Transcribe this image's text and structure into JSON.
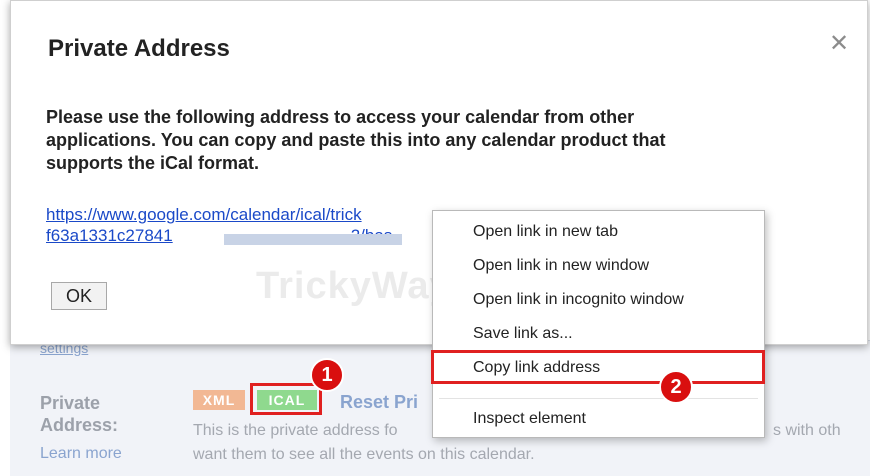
{
  "dialog": {
    "title": "Private Address",
    "close_icon": "close-icon",
    "body_lines": [
      "Please use the following address to access your calendar from other",
      "applications. You can copy and paste this into any calendar product that",
      "supports the iCal format."
    ],
    "url_line1": "https://www.google.com/calendar/ical/trick",
    "url_line2_prefix": "f63a1331c27841",
    "url_line2_suffix": "2/bas",
    "ok_label": "OK",
    "watermark": "TrickyWays.com"
  },
  "settings": {
    "settings_link": "settings",
    "private_address_label_1": "Private",
    "private_address_label_2": "Address:",
    "learn_more": "Learn more",
    "xml_button": "XML",
    "ical_button": "ICAL",
    "reset_link": "Reset Pri",
    "description_line1_start": "This is the private address fo",
    "description_line1_end": "s with oth",
    "description_line2": "want them to see all the events on this calendar."
  },
  "context_menu": {
    "items": [
      "Open link in new tab",
      "Open link in new window",
      "Open link in incognito window",
      "Save link as...",
      "Copy link address",
      "Inspect element"
    ]
  },
  "annotations": {
    "step1": "1",
    "step2": "2",
    "highlight_color": "#e02020"
  }
}
